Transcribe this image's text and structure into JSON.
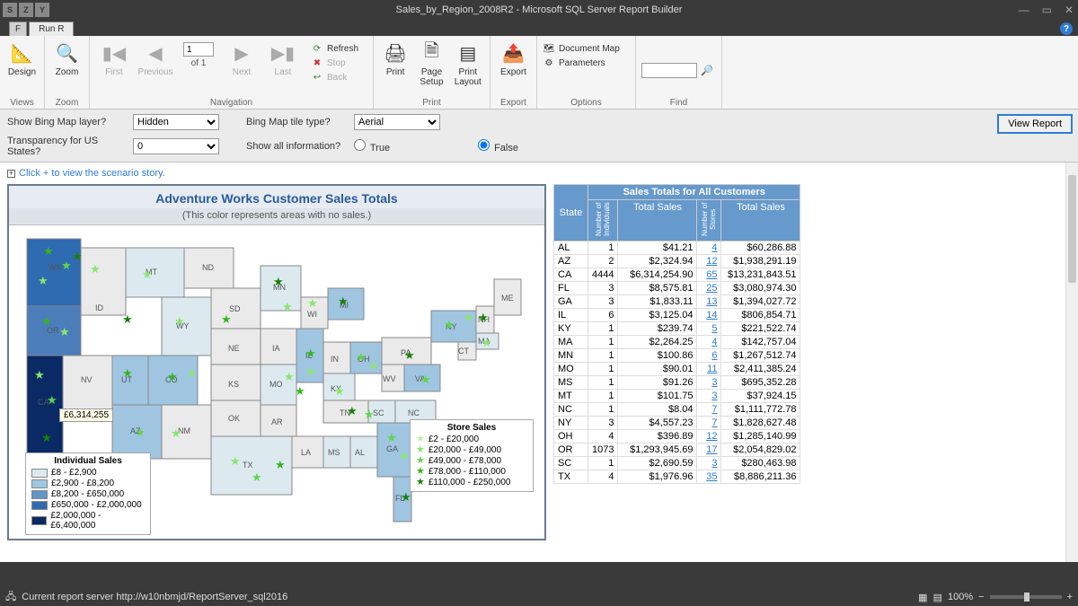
{
  "window": {
    "title": "Sales_by_Region_2008R2 - Microsoft SQL Server Report Builder"
  },
  "tabs": {
    "file": "F",
    "run": "Run R"
  },
  "ribbon": {
    "views": {
      "label": "Views",
      "design": "Design"
    },
    "zoom": {
      "label": "Zoom",
      "zoom": "Zoom"
    },
    "navigation": {
      "label": "Navigation",
      "first": "First",
      "previous": "Previous",
      "page": "1",
      "of": "of  1",
      "next": "Next",
      "last": "Last",
      "refresh": "Refresh",
      "stop": "Stop",
      "back": "Back"
    },
    "print": {
      "label": "Print",
      "print": "Print",
      "page_setup": "Page\nSetup",
      "print_layout": "Print\nLayout"
    },
    "export": {
      "label": "Export",
      "export": "Export"
    },
    "options": {
      "label": "Options",
      "docmap": "Document Map",
      "params": "Parameters"
    },
    "find": {
      "label": "Find"
    }
  },
  "params": {
    "show_layer_label": "Show Bing Map layer?",
    "show_layer_value": "Hidden",
    "tile_type_label": "Bing Map tile type?",
    "tile_type_value": "Aerial",
    "transparency_label": "Transparency for US States?",
    "transparency_value": "0",
    "show_all_label": "Show all information?",
    "true": "True",
    "false": "False",
    "view_report": "View Report"
  },
  "expand_text": "Click + to view the scenario story.",
  "map": {
    "title": "Adventure Works Customer Sales Totals",
    "subtitle": "(This color represents areas with no sales.)",
    "tooltip": "£6,314,255",
    "ind_legend_title": "Individual Sales",
    "ind_legend": [
      "£8 - £2,900",
      "£2,900 - £8,200",
      "£8,200 - £650,000",
      "£650,000 - £2,000,000",
      "£2,000,000 - £6,400,000"
    ],
    "ind_colors": [
      "#dceaf0",
      "#9fc5e1",
      "#5f97c9",
      "#2e6bb0",
      "#0a2a66"
    ],
    "store_legend_title": "Store Sales",
    "store_legend": [
      "£2 - £20,000",
      "£20,000 - £49,000",
      "£49,000 - £78,000",
      "£78,000 - £110,000",
      "£110,000 - £250,000"
    ],
    "store_colors": [
      "#b8f29b",
      "#8ae66f",
      "#5fd548",
      "#35b51f",
      "#158205"
    ]
  },
  "table": {
    "state_hdr": "State",
    "group_hdr": "Sales Totals for All Customers",
    "num_ind": "Number of Individuals",
    "total_sales": "Total Sales",
    "num_stores": "Number of Stores",
    "rows": [
      {
        "st": "AL",
        "ni": "1",
        "ts1": "$41.21",
        "ns": "4",
        "ts2": "$60,286.88"
      },
      {
        "st": "AZ",
        "ni": "2",
        "ts1": "$2,324.94",
        "ns": "12",
        "ts2": "$1,938,291.19"
      },
      {
        "st": "CA",
        "ni": "4444",
        "ts1": "$6,314,254.90",
        "ns": "65",
        "ts2": "$13,231,843.51"
      },
      {
        "st": "FL",
        "ni": "3",
        "ts1": "$8,575.81",
        "ns": "25",
        "ts2": "$3,080,974.30"
      },
      {
        "st": "GA",
        "ni": "3",
        "ts1": "$1,833.11",
        "ns": "13",
        "ts2": "$1,394,027.72"
      },
      {
        "st": "IL",
        "ni": "6",
        "ts1": "$3,125.04",
        "ns": "14",
        "ts2": "$806,854.71"
      },
      {
        "st": "KY",
        "ni": "1",
        "ts1": "$239.74",
        "ns": "5",
        "ts2": "$221,522.74"
      },
      {
        "st": "MA",
        "ni": "1",
        "ts1": "$2,264.25",
        "ns": "4",
        "ts2": "$142,757.04"
      },
      {
        "st": "MN",
        "ni": "1",
        "ts1": "$100.86",
        "ns": "6",
        "ts2": "$1,267,512.74"
      },
      {
        "st": "MO",
        "ni": "1",
        "ts1": "$90.01",
        "ns": "11",
        "ts2": "$2,411,385.24"
      },
      {
        "st": "MS",
        "ni": "1",
        "ts1": "$91.26",
        "ns": "3",
        "ts2": "$695,352.28"
      },
      {
        "st": "MT",
        "ni": "1",
        "ts1": "$101.75",
        "ns": "3",
        "ts2": "$37,924.15"
      },
      {
        "st": "NC",
        "ni": "1",
        "ts1": "$8.04",
        "ns": "7",
        "ts2": "$1,111,772.78"
      },
      {
        "st": "NY",
        "ni": "3",
        "ts1": "$4,557.23",
        "ns": "7",
        "ts2": "$1,828,627.48"
      },
      {
        "st": "OH",
        "ni": "4",
        "ts1": "$396.89",
        "ns": "12",
        "ts2": "$1,285,140.99"
      },
      {
        "st": "OR",
        "ni": "1073",
        "ts1": "$1,293,945.69",
        "ns": "17",
        "ts2": "$2,054,829.02"
      },
      {
        "st": "SC",
        "ni": "1",
        "ts1": "$2,690.59",
        "ns": "3",
        "ts2": "$280,463.98"
      },
      {
        "st": "TX",
        "ni": "4",
        "ts1": "$1,976.96",
        "ns": "35",
        "ts2": "$8,886,211.36"
      }
    ]
  },
  "status": {
    "server": "Current report server http://w10nbmjd/ReportServer_sql2016",
    "zoom": "100%"
  }
}
